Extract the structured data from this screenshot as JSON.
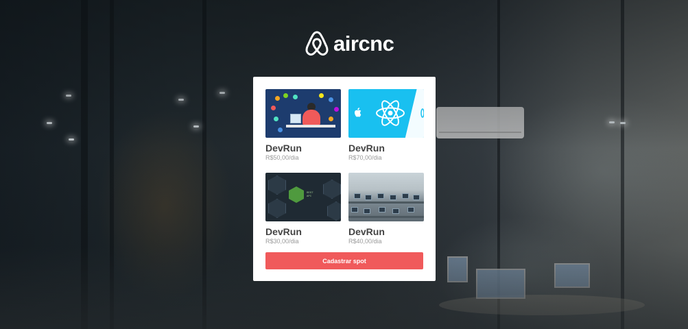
{
  "app": {
    "brand": "aircnc",
    "logo_icon": "airbnb-logo-icon"
  },
  "spots": [
    {
      "company": "DevRun",
      "price": "R$50,00/dia",
      "thumbnail": "developer-illustration"
    },
    {
      "company": "DevRun",
      "price": "R$70,00/dia",
      "thumbnail": "react-logo"
    },
    {
      "company": "DevRun",
      "price": "R$30,00/dia",
      "thumbnail": "nodejs-api"
    },
    {
      "company": "DevRun",
      "price": "R$40,00/dia",
      "thumbnail": "office-workspace"
    }
  ],
  "actions": {
    "register_label": "Cadastrar spot"
  },
  "colors": {
    "accent": "#f05a5b",
    "card": "#ffffff",
    "company_text": "#444444",
    "price_text": "#999999"
  }
}
